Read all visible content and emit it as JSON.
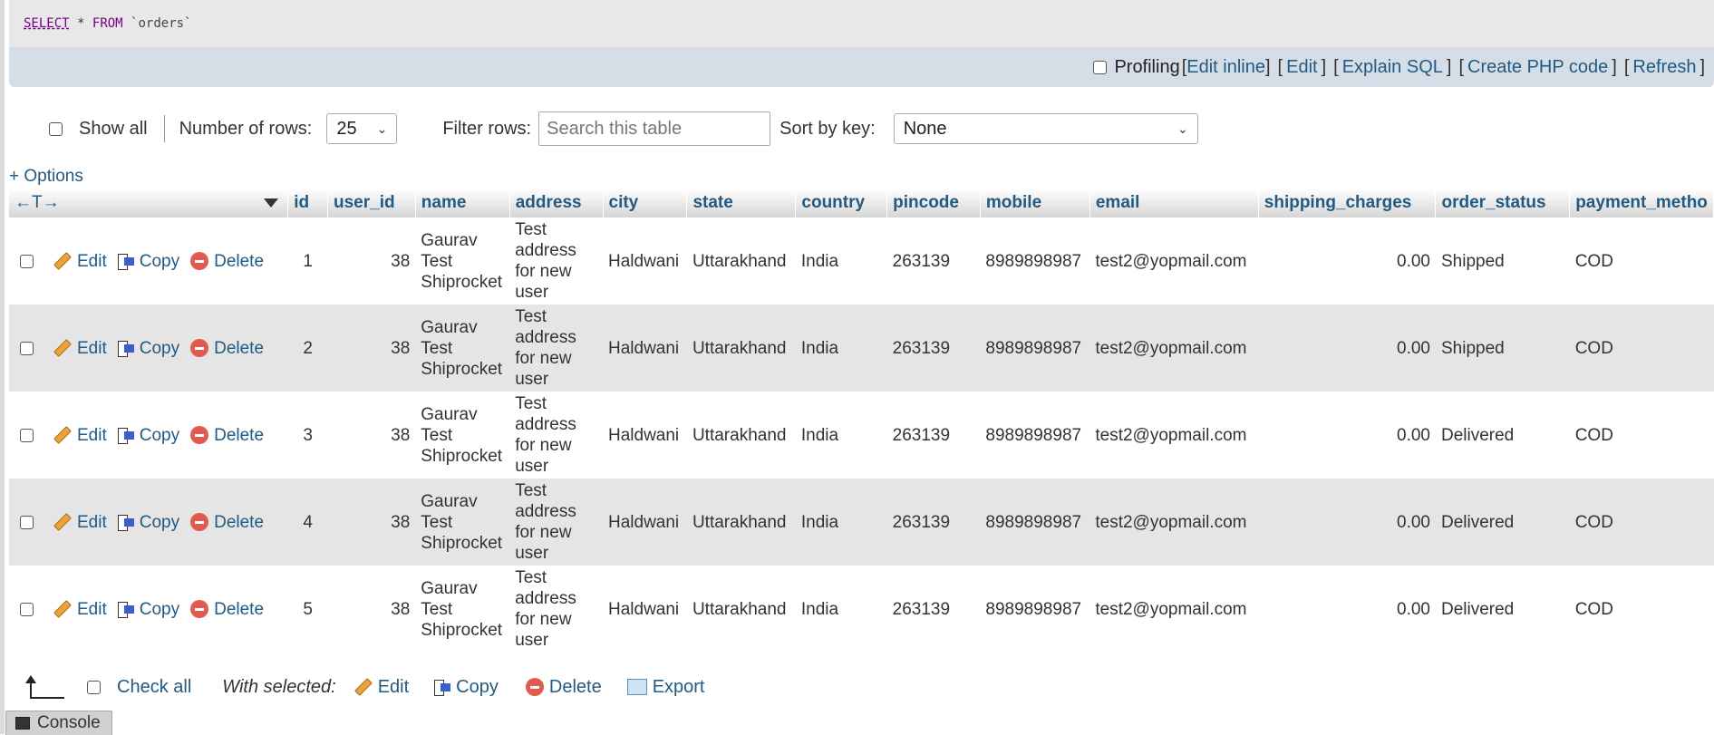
{
  "sql": {
    "select": "SELECT",
    "star": "*",
    "from": "FROM",
    "table": "`orders`"
  },
  "links_bar": {
    "profiling": "Profiling",
    "edit_inline": "Edit inline",
    "edit": "Edit",
    "explain_sql": "Explain SQL",
    "create_php": "Create PHP code",
    "refresh": "Refresh"
  },
  "nav": {
    "show_all": "Show all",
    "rows_label": "Number of rows:",
    "rows_value": "25",
    "filter_label": "Filter rows:",
    "filter_placeholder": "Search this table",
    "sort_label": "Sort by key:",
    "sort_value": "None"
  },
  "options_link": "+ Options",
  "table": {
    "header_arrows": "←T→",
    "columns": [
      "id",
      "user_id",
      "name",
      "address",
      "city",
      "state",
      "country",
      "pincode",
      "mobile",
      "email",
      "shipping_charges",
      "order_status",
      "payment_metho"
    ],
    "action_labels": {
      "edit": "Edit",
      "copy": "Copy",
      "delete": "Delete"
    },
    "rows": [
      {
        "id": "1",
        "user_id": "38",
        "name": "Gaurav Test Shiprocket",
        "address": "Test address for new user",
        "city": "Haldwani",
        "state": "Uttarakhand",
        "country": "India",
        "pincode": "263139",
        "mobile": "8989898987",
        "email": "test2@yopmail.com",
        "shipping_charges": "0.00",
        "order_status": "Shipped",
        "payment_method": "COD"
      },
      {
        "id": "2",
        "user_id": "38",
        "name": "Gaurav Test Shiprocket",
        "address": "Test address for new user",
        "city": "Haldwani",
        "state": "Uttarakhand",
        "country": "India",
        "pincode": "263139",
        "mobile": "8989898987",
        "email": "test2@yopmail.com",
        "shipping_charges": "0.00",
        "order_status": "Shipped",
        "payment_method": "COD"
      },
      {
        "id": "3",
        "user_id": "38",
        "name": "Gaurav Test Shiprocket",
        "address": "Test address for new user",
        "city": "Haldwani",
        "state": "Uttarakhand",
        "country": "India",
        "pincode": "263139",
        "mobile": "8989898987",
        "email": "test2@yopmail.com",
        "shipping_charges": "0.00",
        "order_status": "Delivered",
        "payment_method": "COD"
      },
      {
        "id": "4",
        "user_id": "38",
        "name": "Gaurav Test Shiprocket",
        "address": "Test address for new user",
        "city": "Haldwani",
        "state": "Uttarakhand",
        "country": "India",
        "pincode": "263139",
        "mobile": "8989898987",
        "email": "test2@yopmail.com",
        "shipping_charges": "0.00",
        "order_status": "Delivered",
        "payment_method": "COD"
      },
      {
        "id": "5",
        "user_id": "38",
        "name": "Gaurav Test Shiprocket",
        "address": "Test address for new user",
        "city": "Haldwani",
        "state": "Uttarakhand",
        "country": "India",
        "pincode": "263139",
        "mobile": "8989898987",
        "email": "test2@yopmail.com",
        "shipping_charges": "0.00",
        "order_status": "Delivered",
        "payment_method": "COD"
      }
    ]
  },
  "footer": {
    "check_all": "Check all",
    "with_selected": "With selected:",
    "edit": "Edit",
    "copy": "Copy",
    "delete": "Delete",
    "export": "Export"
  },
  "console_tab": "Console"
}
